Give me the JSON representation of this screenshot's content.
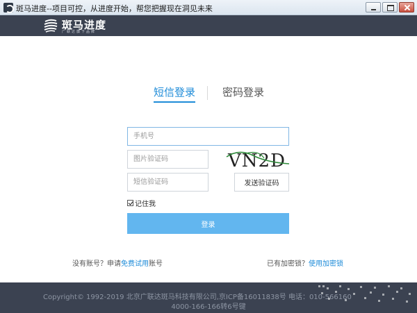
{
  "window": {
    "title": "斑马进度--项目可控，从进度开始，帮您把握现在洞见未来"
  },
  "header": {
    "logo_name": "斑马进度",
    "logo_slogan": "广联达旗下品牌"
  },
  "tabs": {
    "sms_login": "短信登录",
    "password_login": "密码登录",
    "active": "sms_login"
  },
  "form": {
    "phone_placeholder": "手机号",
    "captcha_placeholder": "图片验证码",
    "sms_code_placeholder": "短信验证码",
    "captcha_image_text": "VN2D",
    "send_code_label": "发送验证码",
    "remember_label": "记住我",
    "remember_checked": true,
    "login_label": "登录"
  },
  "links": {
    "no_account_prefix": "没有账号？申请",
    "trial_link": "免费试用",
    "no_account_suffix": "账号",
    "has_key_prefix": "已有加密锁？",
    "use_key_link": "使用加密锁"
  },
  "footer": {
    "copyright": "Copyright© 1992-2019 北京广联达斑马科技有限公司,京ICP备16011838号 电话：010-566160",
    "hotline": "4000-166-166转6号键"
  },
  "colors": {
    "accent": "#1d8bd8",
    "login_button": "#62b6ef",
    "header_bg": "#3b4251"
  }
}
